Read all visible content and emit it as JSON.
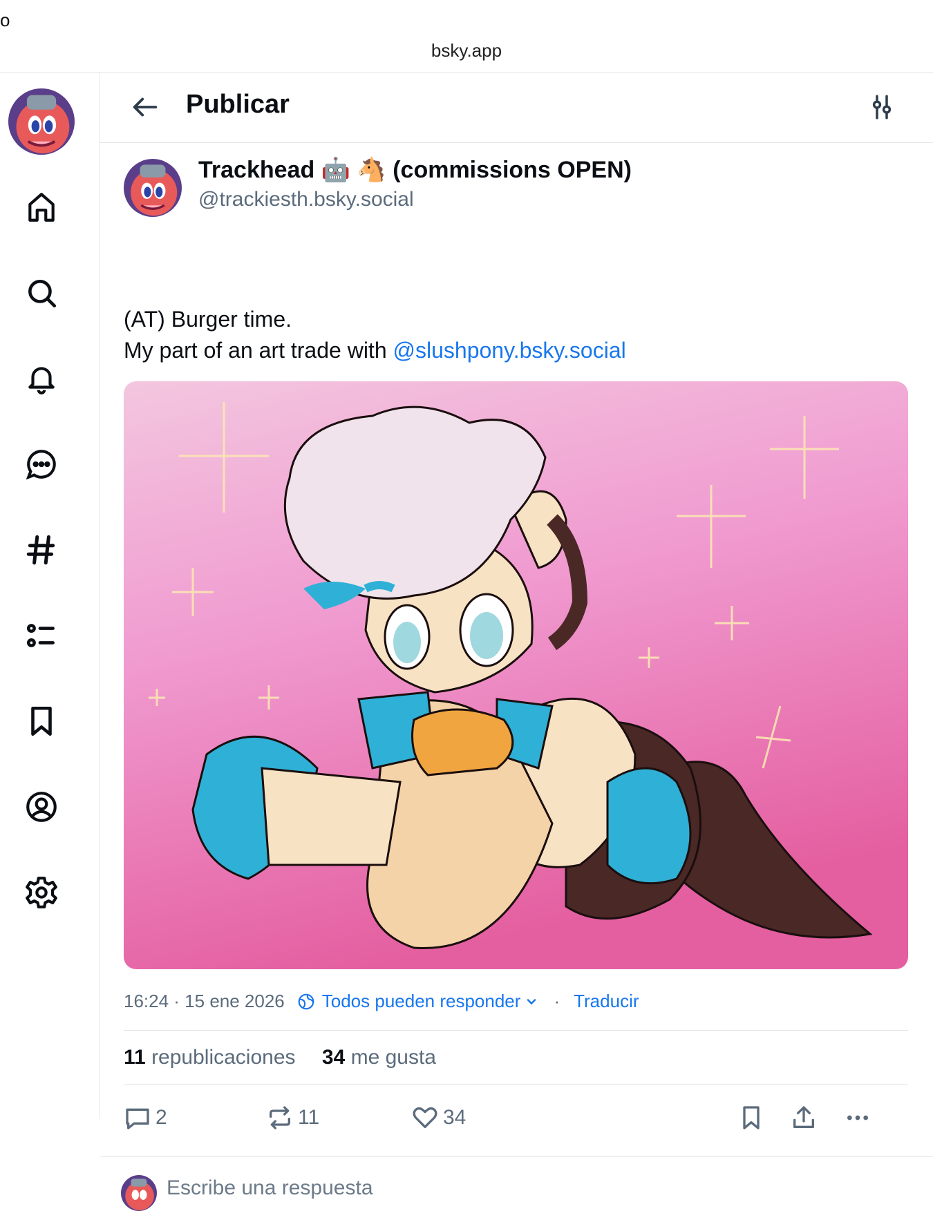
{
  "browser": {
    "corner_char": "o",
    "url": "bsky.app"
  },
  "header": {
    "title": "Publicar"
  },
  "author": {
    "name": "Trackhead 🤖 🐴 (commissions OPEN)",
    "handle": "@trackiesth.bsky.social"
  },
  "post": {
    "line1": "(AT) Burger time.",
    "line2_prefix": "My part of an art trade with ",
    "mention": "@slushpony.bsky.social"
  },
  "meta": {
    "timestamp": "16:24 · 15 ene 2026",
    "reply_setting": "Todos pueden responder",
    "separator": "·",
    "translate": "Traducir"
  },
  "stats": {
    "reposts_count": "11",
    "reposts_label": "republicaciones",
    "likes_count": "34",
    "likes_label": "me gusta"
  },
  "actions": {
    "replies": "2",
    "reposts": "11",
    "likes": "34"
  },
  "reply_box": {
    "placeholder": "Escribe una respuesta"
  },
  "colors": {
    "accent": "#1877ed",
    "muted": "#5b6b7b",
    "border": "#e3e6ea"
  }
}
